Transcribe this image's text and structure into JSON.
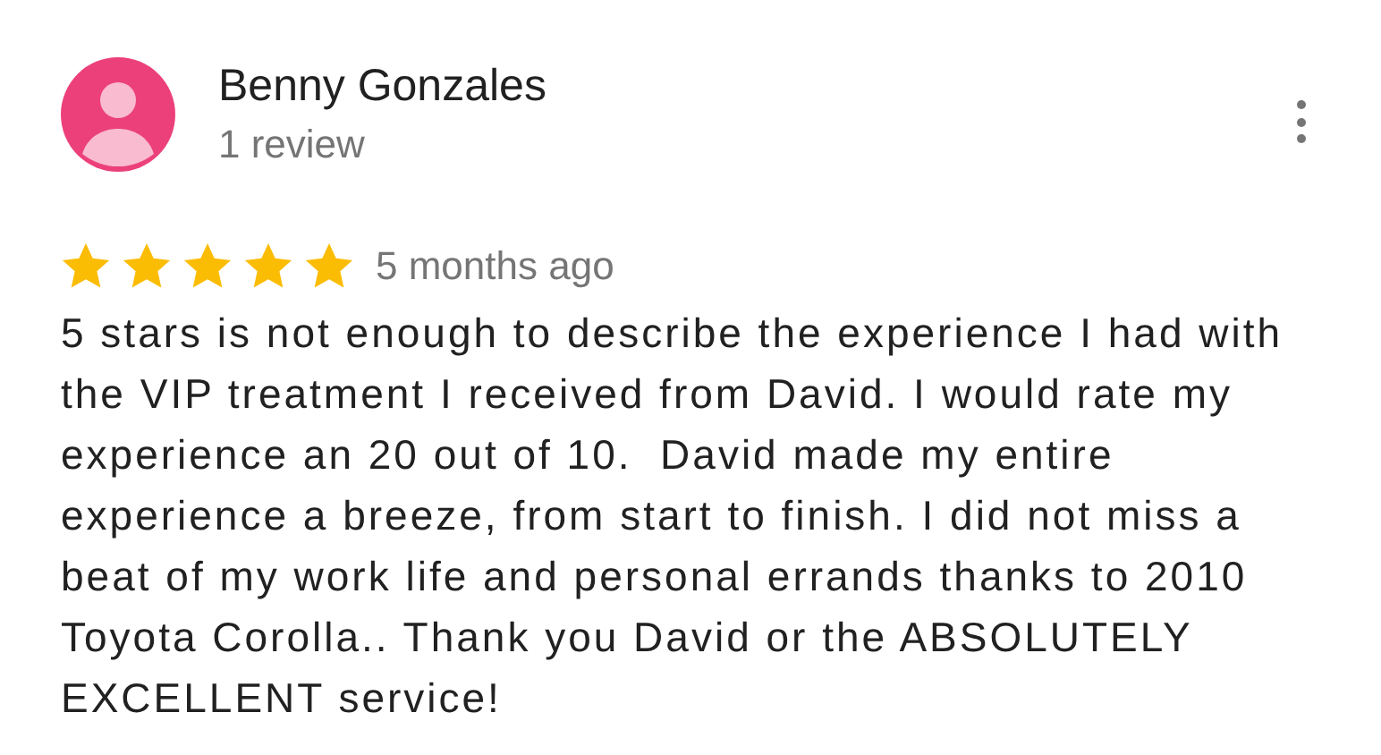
{
  "review": {
    "author": "Benny Gonzales",
    "review_count": "1 review",
    "stars": 5,
    "time": "5 months ago",
    "text": "5 stars is not enough to describe the experience I had with the VIP treatment I received from David. I would rate my experience an 20 out of 10.  David made my entire experience a breeze, from start to finish. I did not miss a beat of my work life and personal errands thanks to 2010 Toyota Corolla.. Thank you David or the ABSOLUTELY EXCELLENT service!"
  }
}
